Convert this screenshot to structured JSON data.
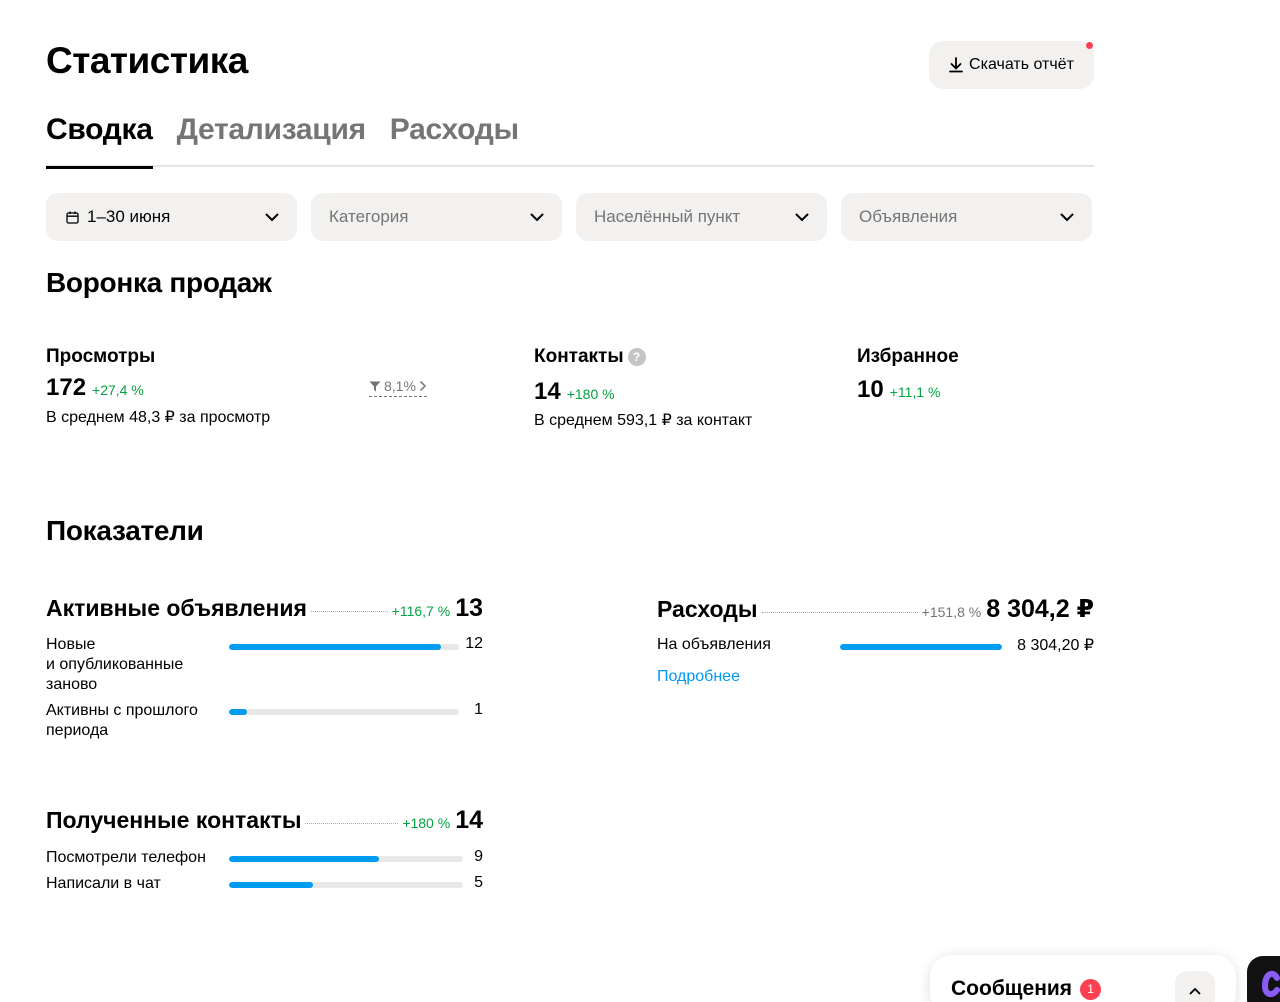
{
  "header": {
    "title": "Статистика",
    "download_label": "Скачать отчёт"
  },
  "tabs": [
    {
      "label": "Сводка",
      "active": true
    },
    {
      "label": "Детализация",
      "active": false
    },
    {
      "label": "Расходы",
      "active": false
    }
  ],
  "filters": {
    "period": "1–30 июня",
    "category": "Категория",
    "location": "Населённый пункт",
    "ads": "Объявления"
  },
  "funnel": {
    "title": "Воронка продаж",
    "views": {
      "label": "Просмотры",
      "value": "172",
      "delta": "+27,4 %",
      "sub": "В среднем 48,3 ₽ за просмотр",
      "conversion": "8,1%"
    },
    "contacts": {
      "label": "Контакты",
      "help": "?",
      "value": "14",
      "delta": "+180 %",
      "sub": "В среднем 593,1 ₽ за контакт"
    },
    "favorites": {
      "label": "Избранное",
      "value": "10",
      "delta": "+11,1 %"
    }
  },
  "indicators": {
    "title": "Показатели",
    "active_ads": {
      "title": "Активные объявления",
      "delta": "+116,7 %",
      "value": "13",
      "rows": [
        {
          "label_lines": [
            "Новые",
            "и опубликованные",
            "заново"
          ],
          "value": "12",
          "fraction": 0.923
        },
        {
          "label_lines": [
            "Активны с прошлого",
            "периода"
          ],
          "value": "1",
          "fraction": 0.077
        }
      ]
    },
    "expenses": {
      "title": "Расходы",
      "delta": "+151,8 %",
      "value": "8 304,2 ₽",
      "rows": [
        {
          "label": "На объявления",
          "value": "8 304,20 ₽",
          "fraction": 1.0
        }
      ],
      "more_link": "Подробнее"
    },
    "contacts": {
      "title": "Полученные контакты",
      "delta": "+180 %",
      "value": "14",
      "rows": [
        {
          "label": "Посмотрели телефон",
          "value": "9",
          "fraction": 0.643
        },
        {
          "label": "Написали в чат",
          "value": "5",
          "fraction": 0.357
        }
      ]
    }
  },
  "messenger": {
    "title": "Сообщения",
    "unread": "1"
  },
  "colors": {
    "accent": "#009cf0",
    "positive": "#02a341",
    "badge": "#ff4053",
    "link": "#0099f7"
  }
}
